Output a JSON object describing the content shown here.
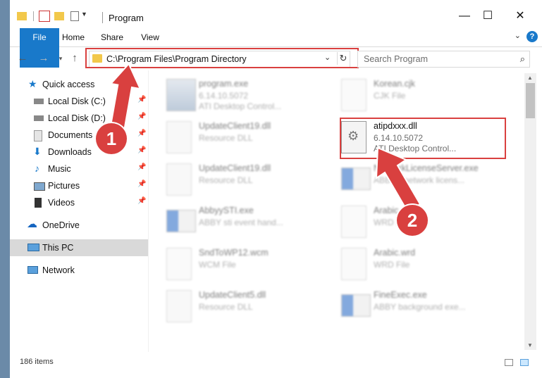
{
  "window": {
    "title": "Program"
  },
  "window_controls": {
    "minimize": "—",
    "maximize": "☐",
    "close": "✕"
  },
  "ribbon": {
    "tabs": [
      {
        "label": "File"
      },
      {
        "label": "Home"
      },
      {
        "label": "Share"
      },
      {
        "label": "View"
      }
    ],
    "help": "?"
  },
  "address_bar": {
    "path": "C:\\Program Files\\Program Directory"
  },
  "search": {
    "placeholder": "Search Program"
  },
  "nav_pane": {
    "items": [
      {
        "label": "Quick access"
      },
      {
        "label": "Local Disk (C:)"
      },
      {
        "label": "Local Disk (D:)"
      },
      {
        "label": "Documents"
      },
      {
        "label": "Downloads"
      },
      {
        "label": "Music"
      },
      {
        "label": "Pictures"
      },
      {
        "label": "Videos"
      },
      {
        "label": "OneDrive"
      },
      {
        "label": "This PC"
      },
      {
        "label": "Network"
      }
    ]
  },
  "files": [
    {
      "name": "program.exe",
      "line2": "6.14.10.5072",
      "line3": "ATI Desktop Control..."
    },
    {
      "name": "Korean.cjk",
      "line2": "CJK File",
      "line3": ""
    },
    {
      "name": "UpdateClient19.dll",
      "line2": "Resource DLL",
      "line3": ""
    },
    {
      "name": "atipdxxx.dll",
      "line2": "6.14.10.5072",
      "line3": "ATI Desktop Control..."
    },
    {
      "name": "UpdateClient19.dll",
      "line2": "Resource DLL",
      "line3": ""
    },
    {
      "name": "NetworkLicenseServer.exe",
      "line2": "ABBYY network licens...",
      "line3": ""
    },
    {
      "name": "AbbyySTI.exe",
      "line2": "ABBY sti event hand...",
      "line3": ""
    },
    {
      "name": "Arabic.ed",
      "line2": "WRD File",
      "line3": ""
    },
    {
      "name": "SndToWP12.wcm",
      "line2": "WCM File",
      "line3": ""
    },
    {
      "name": "Arabic.wrd",
      "line2": "WRD File",
      "line3": ""
    },
    {
      "name": "UpdateClient5.dll",
      "line2": "Resource DLL",
      "line3": ""
    },
    {
      "name": "FineExec.exe",
      "line2": "ABBY background exe...",
      "line3": ""
    }
  ],
  "status_bar": {
    "item_count": "186 items"
  },
  "callouts": [
    {
      "number": "1"
    },
    {
      "number": "2"
    }
  ],
  "colors": {
    "accent": "#1979ca",
    "highlight": "#d9403f",
    "selected": "#cce8ff"
  }
}
